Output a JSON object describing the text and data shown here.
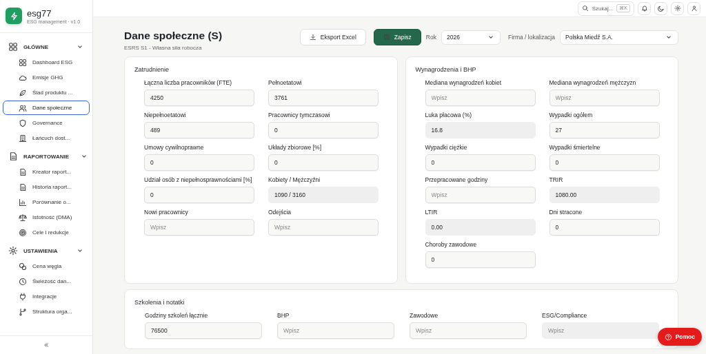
{
  "brand": {
    "name": "esg77",
    "subtitle": "ESG management · v1.0"
  },
  "sidebar": {
    "groups": [
      {
        "label": "GŁÓWNE",
        "expanded": true,
        "items": [
          {
            "label": "Dashboard ESG",
            "selected": false
          },
          {
            "label": "Emisje GHG",
            "selected": false
          },
          {
            "label": "Ślad produktu ...",
            "selected": false
          },
          {
            "label": "Dane społeczne",
            "selected": true
          },
          {
            "label": "Governance",
            "selected": false
          },
          {
            "label": "Łańcuch dost...",
            "selected": false
          }
        ]
      },
      {
        "label": "RAPORTOWANIE",
        "expanded": true,
        "items": [
          {
            "label": "Kreator raport...",
            "selected": false
          },
          {
            "label": "Historia raport...",
            "selected": false
          },
          {
            "label": "Porównanie o...",
            "selected": false
          },
          {
            "label": "Istotność (DMA)",
            "selected": false
          },
          {
            "label": "Cele i redukcje",
            "selected": false
          }
        ]
      },
      {
        "label": "USTAWIENIA",
        "expanded": true,
        "items": [
          {
            "label": "Cena węgla",
            "selected": false
          },
          {
            "label": "Świeżość dan...",
            "selected": false
          },
          {
            "label": "Integracje",
            "selected": false
          },
          {
            "label": "Struktura orga...",
            "selected": false
          }
        ]
      }
    ]
  },
  "topbar": {
    "search": {
      "placeholder": "Szukaj...",
      "shortcut": "⌘K"
    }
  },
  "header": {
    "title": "Dane społeczne (S)",
    "subtitle": "ESRS S1 - Własna siła robocza",
    "export_button": "Eksport Excel",
    "save_button": "Zapisz",
    "year_label": "Rok",
    "year": "2026",
    "company_label": "Firma / lokalizacja",
    "company": "Polska Miedź S.A."
  },
  "cards": [
    {
      "title": "Zatrudnienie",
      "fields": [
        {
          "label": "Łączna liczba pracowników (FTE)",
          "value": "4250",
          "readonly": false
        },
        {
          "label": "Pełnoetatowi",
          "value": "3761",
          "readonly": false
        },
        {
          "label": "Niepełnoetatowi",
          "value": "489",
          "readonly": false
        },
        {
          "label": "Pracownicy tymczasowi",
          "value": "0",
          "readonly": false
        },
        {
          "label": "Umowy cywilnoprawne",
          "value": "0",
          "readonly": false
        },
        {
          "label": "Układy zbiorowe [%]",
          "value": "0",
          "readonly": false
        },
        {
          "label": "Udział osób z niepełnosprawnościami [%]",
          "value": "0",
          "readonly": false
        },
        {
          "label": "Kobiety / Mężczyźni",
          "value": "1090 / 3160",
          "readonly": true
        },
        {
          "label": "Nowi pracownicy",
          "placeholder": "Wpisz",
          "readonly": false
        },
        {
          "label": "Odejścia",
          "placeholder": "Wpisz",
          "readonly": false
        }
      ]
    },
    {
      "title": "Wynagrodzenia i BHP",
      "fields": [
        {
          "label": "Mediana wynagrodzeń kobiet",
          "placeholder": "Wpisz",
          "readonly": false
        },
        {
          "label": "Mediana wynagrodzeń mężczyzn",
          "placeholder": "Wpisz",
          "readonly": false
        },
        {
          "label": "Luka płacowa (%)",
          "value": "16.8",
          "readonly": true
        },
        {
          "label": "Wypadki ogółem",
          "value": "27",
          "readonly": false
        },
        {
          "label": "Wypadki ciężkie",
          "value": "0",
          "readonly": false
        },
        {
          "label": "Wypadki śmiertelne",
          "value": "0",
          "readonly": false
        },
        {
          "label": "Przepracowane godziny",
          "placeholder": "Wpisz",
          "readonly": false
        },
        {
          "label": "TRIR",
          "value": "1080.00",
          "readonly": true
        },
        {
          "label": "LTIR",
          "value": "0.00",
          "readonly": true
        },
        {
          "label": "Dni stracone",
          "value": "0",
          "readonly": false
        },
        {
          "label": "Choroby zawodowe",
          "value": "0",
          "readonly": false
        }
      ]
    },
    {
      "title": "Szkolenia i notatki",
      "fields": [
        {
          "label": "Godziny szkoleń łącznie",
          "value": "76500",
          "readonly": false
        },
        {
          "label": "BHP",
          "placeholder": "Wpisz",
          "readonly": false
        },
        {
          "label": "Zawodowe",
          "placeholder": "Wpisz",
          "readonly": false
        },
        {
          "label": "ESG/Compliance",
          "placeholder": "Wpisz",
          "readonly": true
        }
      ]
    }
  ],
  "help_button": "Pomoc"
}
